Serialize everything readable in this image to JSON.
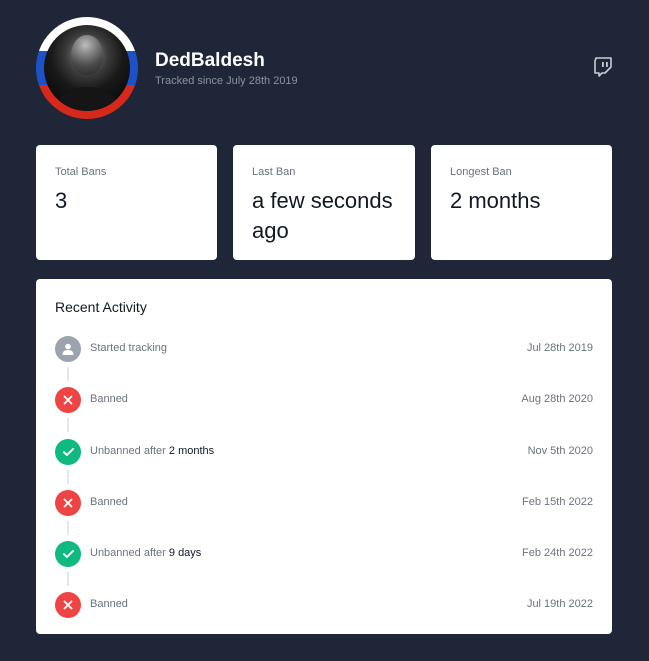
{
  "profile": {
    "name": "DedBaldesh",
    "tracked_since": "Tracked since July 28th 2019",
    "platform_icon": "twitch-icon"
  },
  "stats": [
    {
      "label": "Total Bans",
      "value": "3"
    },
    {
      "label": "Last Ban",
      "value": "a few seconds ago"
    },
    {
      "label": "Longest Ban",
      "value": "2 months"
    }
  ],
  "activity": {
    "title": "Recent Activity",
    "events": [
      {
        "icon": "user-icon",
        "status": "neutral",
        "text": "Started tracking",
        "emphasis": "",
        "date": "Jul 28th 2019"
      },
      {
        "icon": "x-icon",
        "status": "banned",
        "text": "Banned",
        "emphasis": "",
        "date": "Aug 28th 2020"
      },
      {
        "icon": "check-icon",
        "status": "unbanned",
        "text": "Unbanned after ",
        "emphasis": "2 months",
        "date": "Nov 5th 2020"
      },
      {
        "icon": "x-icon",
        "status": "banned",
        "text": "Banned",
        "emphasis": "",
        "date": "Feb 15th 2022"
      },
      {
        "icon": "check-icon",
        "status": "unbanned",
        "text": "Unbanned after ",
        "emphasis": "9 days",
        "date": "Feb 24th 2022"
      },
      {
        "icon": "x-icon",
        "status": "banned",
        "text": "Banned",
        "emphasis": "",
        "date": "Jul 19th 2022"
      }
    ]
  },
  "colors": {
    "background": "#1f2637",
    "card": "#ffffff",
    "banned": "#ef4444",
    "unbanned": "#10b981",
    "neutral": "#9ca3af"
  }
}
